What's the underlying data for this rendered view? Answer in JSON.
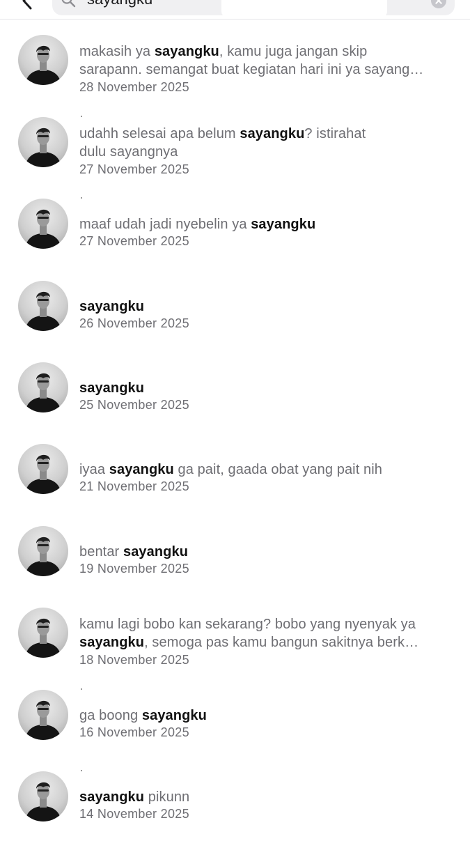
{
  "search": {
    "query": "sayangku"
  },
  "results": [
    {
      "lines": [
        [
          {
            "t": "makasih ya ",
            "b": false
          },
          {
            "t": "sayangku",
            "b": true
          },
          {
            "t": ", kamu juga jangan skip",
            "b": false
          }
        ],
        [
          {
            "t": "sarapann. semangat buat kegiatan hari ini ya sayang…",
            "b": false
          }
        ]
      ],
      "date": "28 November 2025"
    },
    {
      "lines": [
        [
          {
            "t": "udahh selesai apa belum ",
            "b": false
          },
          {
            "t": "sayangku",
            "b": true
          },
          {
            "t": "? istirahat",
            "b": false
          }
        ],
        [
          {
            "t": "dulu sayangnya",
            "b": false
          }
        ]
      ],
      "date": "27 November 2025"
    },
    {
      "lines": [
        [
          {
            "t": "maaf udah jadi nyebelin ya ",
            "b": false
          },
          {
            "t": "sayangku",
            "b": true
          }
        ]
      ],
      "date": "27 November 2025"
    },
    {
      "lines": [
        [
          {
            "t": "sayangku",
            "b": true
          }
        ]
      ],
      "date": "26 November 2025"
    },
    {
      "lines": [
        [
          {
            "t": "sayangku",
            "b": true
          }
        ]
      ],
      "date": "25 November 2025"
    },
    {
      "lines": [
        [
          {
            "t": "iyaa ",
            "b": false
          },
          {
            "t": "sayangku",
            "b": true
          },
          {
            "t": " ga pait, gaada obat yang pait nih",
            "b": false
          }
        ]
      ],
      "date": "21 November 2025"
    },
    {
      "lines": [
        [
          {
            "t": "bentar ",
            "b": false
          },
          {
            "t": "sayangku",
            "b": true
          }
        ]
      ],
      "date": "19 November 2025"
    },
    {
      "lines": [
        [
          {
            "t": "kamu lagi bobo kan sekarang? bobo yang nyenyak ya",
            "b": false
          }
        ],
        [
          {
            "t": "sayangku",
            "b": true
          },
          {
            "t": ", semoga pas kamu bangun sakitnya berk…",
            "b": false
          }
        ]
      ],
      "date": "18 November 2025"
    },
    {
      "lines": [
        [
          {
            "t": "ga boong ",
            "b": false
          },
          {
            "t": "sayangku",
            "b": true
          }
        ]
      ],
      "date": "16 November 2025"
    },
    {
      "lines": [
        [
          {
            "t": "sayangku",
            "b": true
          },
          {
            "t": " pikunn",
            "b": false
          }
        ]
      ],
      "date": "14 November 2025"
    }
  ]
}
